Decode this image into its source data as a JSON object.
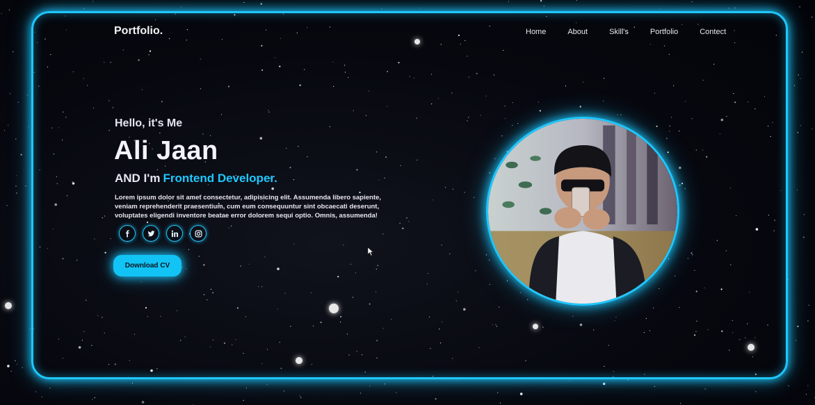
{
  "header": {
    "logo": "Portfolio.",
    "nav": [
      "Home",
      "About",
      "Skill's",
      "Portfolio",
      "Contect"
    ]
  },
  "hero": {
    "greeting": "Hello, it's Me",
    "name": "Ali Jaan",
    "role_prefix": "AND I'm",
    "role_highlight": "Frontend Developer.",
    "description": "Lorem ipsum dolor sit amet consectetur, adipisicing elit. Assumenda libero sapiente, veniam reprehenderit praesentium, cum eum consequuntur sint obcaecati deserunt, voluptates eligendi inventore beatae error dolorem sequi optio. Omnis, assumenda!",
    "download_label": "Download CV"
  },
  "socials": [
    "facebook-icon",
    "twitter-icon",
    "linkedin-icon",
    "instagram-icon"
  ],
  "colors": {
    "accent": "#1ec8ff",
    "background": "#05060c",
    "text": "#f2f2f5"
  }
}
